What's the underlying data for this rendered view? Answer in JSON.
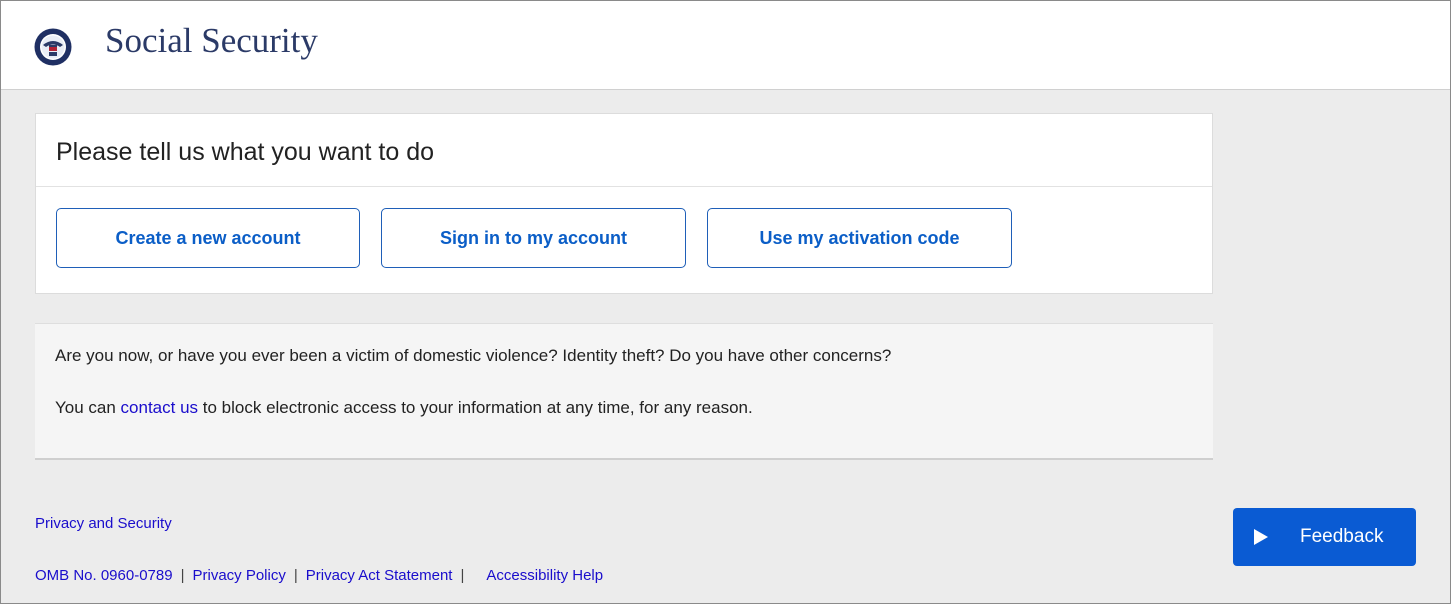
{
  "header": {
    "seal_icon": "ssa-seal-icon",
    "brand": "Social Security"
  },
  "task_card": {
    "title": "Please tell us what you want to do",
    "buttons": [
      {
        "label": "Create a new account"
      },
      {
        "label": "Sign in to my account"
      },
      {
        "label": "Use my activation code"
      }
    ]
  },
  "notice": {
    "line1": "Are you now, or have you ever been a victim of domestic violence? Identity theft? Do you have other concerns?",
    "line2_before": "You can ",
    "line2_link": "contact us",
    "line2_after": " to block electronic access to your information at any time, for any reason."
  },
  "footer": {
    "privacy_security": "Privacy and Security",
    "omb": "OMB No. 0960-0789",
    "privacy_policy": "Privacy Policy",
    "privacy_act": "Privacy Act Statement",
    "accessibility": "Accessibility Help",
    "separator": "|"
  },
  "feedback": {
    "label": "Feedback",
    "icon": "play-triangle-icon"
  },
  "colors": {
    "link": "#1a0dcc",
    "button_text": "#0b5ec7",
    "feedback_bg": "#0a5bd3",
    "brand_text": "#2b3a67"
  }
}
